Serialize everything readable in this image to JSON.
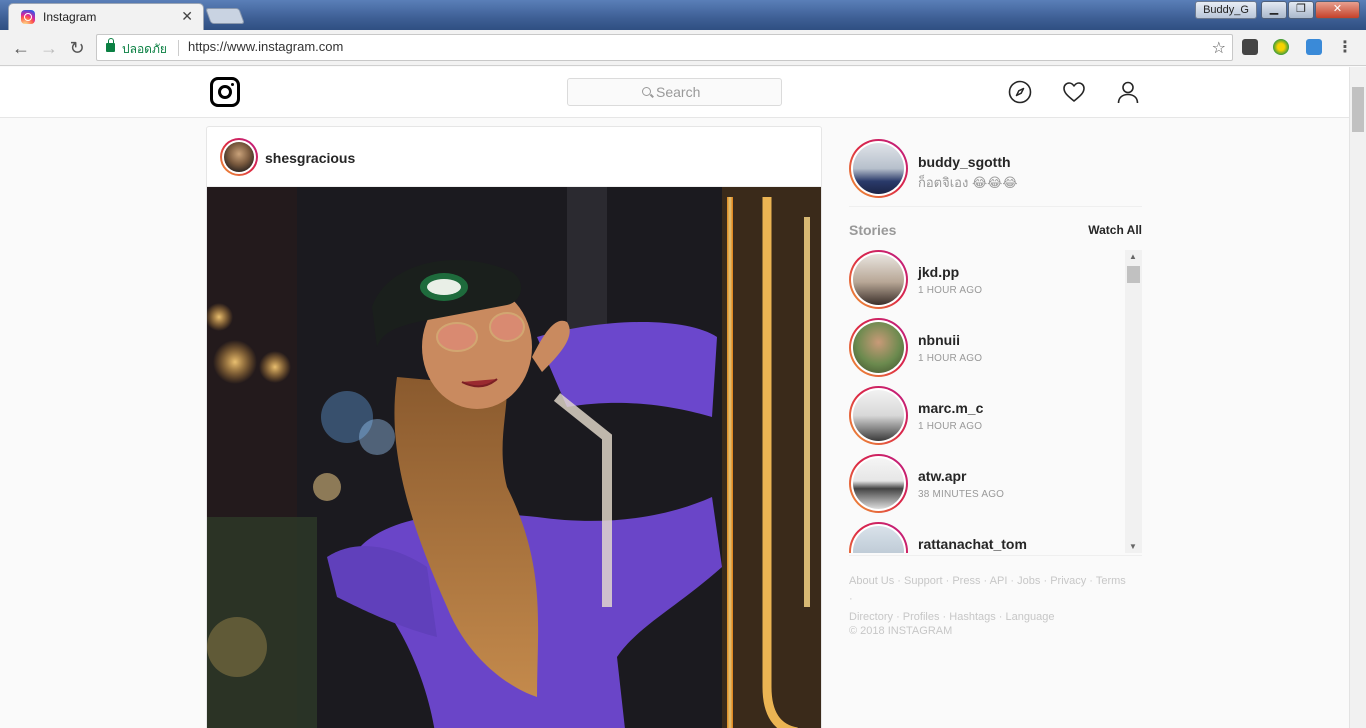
{
  "browser": {
    "tab_title": "Instagram",
    "tab_close": "✕",
    "profile_name": "Buddy_G",
    "secure_label": "ปลอดภัย",
    "url": "https://www.instagram.com",
    "window_controls": {
      "minimize": "▁",
      "maximize": "❐",
      "close": "✕"
    }
  },
  "header": {
    "search_placeholder": "Search",
    "icons": [
      "instagram-logo-icon",
      "explore-compass-icon",
      "activity-heart-icon",
      "profile-person-icon"
    ]
  },
  "post": {
    "username": "shesgracious"
  },
  "current_user": {
    "username": "buddy_sgotth",
    "full_name": "ก็อตจิเอง 😂😂😂"
  },
  "stories": {
    "title": "Stories",
    "watch_all": "Watch All",
    "items": [
      {
        "username": "jkd.pp",
        "time": "1 HOUR AGO"
      },
      {
        "username": "nbnuii",
        "time": "1 HOUR AGO"
      },
      {
        "username": "marc.m_c",
        "time": "1 HOUR AGO"
      },
      {
        "username": "atw.apr",
        "time": "38 MINUTES AGO"
      },
      {
        "username": "rattanachat_tom",
        "time": ""
      }
    ]
  },
  "footer": {
    "links": [
      "About Us",
      "Support",
      "Press",
      "API",
      "Jobs",
      "Privacy",
      "Terms",
      "Directory",
      "Profiles",
      "Hashtags",
      "Language"
    ],
    "copyright": "© 2018 INSTAGRAM"
  },
  "colors": {
    "story_ring_start": "#f09433",
    "story_ring_end": "#bc1888",
    "secure_green": "#0b8043",
    "muted_text": "#999999"
  }
}
